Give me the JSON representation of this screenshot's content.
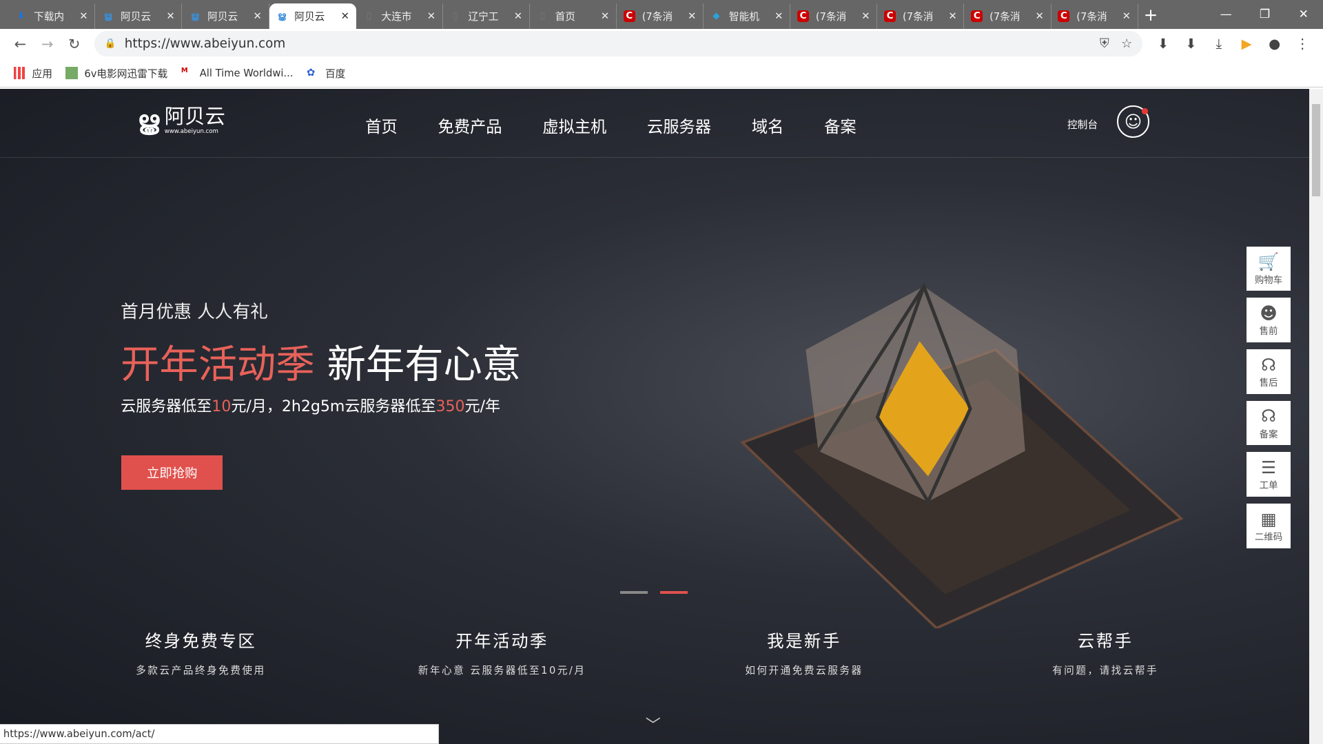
{
  "browser": {
    "tabs": [
      {
        "title": "下载内",
        "icon": "download-icon",
        "color": "#1a73e8"
      },
      {
        "title": "阿贝云",
        "icon": "abeiyun-icon",
        "color": "#3b8fd8"
      },
      {
        "title": "阿贝云",
        "icon": "abeiyun-icon",
        "color": "#3b8fd8"
      },
      {
        "title": "阿贝云",
        "icon": "abeiyun-icon",
        "color": "#3b8fd8",
        "active": true
      },
      {
        "title": "大连市",
        "icon": "page-icon",
        "color": "#777"
      },
      {
        "title": "辽宁工",
        "icon": "page-icon",
        "color": "#777"
      },
      {
        "title": "首页",
        "icon": "page-icon",
        "color": "#777"
      },
      {
        "title": "(7条消",
        "icon": "csdn-icon",
        "color": "#c00"
      },
      {
        "title": "智能机",
        "icon": "globe-icon",
        "color": "#2aa3d8"
      },
      {
        "title": "(7条消",
        "icon": "csdn-icon",
        "color": "#c00"
      },
      {
        "title": "(7条消",
        "icon": "csdn-icon",
        "color": "#c00"
      },
      {
        "title": "(7条消",
        "icon": "csdn-icon",
        "color": "#c00"
      },
      {
        "title": "(7条消",
        "icon": "csdn-icon",
        "color": "#c00"
      }
    ],
    "url": "https://www.abeiyun.com",
    "bookmarks": [
      "应用",
      "6v电影网迅雷下载",
      "All Time Worldwi...",
      "百度"
    ],
    "status_url": "https://www.abeiyun.com/act/"
  },
  "site": {
    "logo_name": "阿贝云",
    "logo_sub": "www.abeiyun.com",
    "menu": [
      "首页",
      "免费产品",
      "虚拟主机",
      "云服务器",
      "域名",
      "备案"
    ],
    "console": "控制台",
    "hero": {
      "kicker": "首月优惠 人人有礼",
      "title_red": "开年活动季",
      "title_white": " 新年有心意",
      "line_a": "云服务器低至",
      "price1": "10",
      "line_b": "元/月，2h2g5m云服务器低至",
      "price2": "350",
      "line_c": "元/年",
      "button": "立即抢购",
      "slide_count": 2,
      "active_slide": 2
    },
    "features": [
      {
        "title": "终身免费专区",
        "sub": "多款云产品终身免费使用"
      },
      {
        "title": "开年活动季",
        "sub": "新年心意 云服务器低至10元/月"
      },
      {
        "title": "我是新手",
        "sub": "如何开通免费云服务器"
      },
      {
        "title": "云帮手",
        "sub": "有问题，请找云帮手"
      }
    ],
    "side": [
      {
        "label": "购物车",
        "icon": "cart-icon"
      },
      {
        "label": "售前",
        "icon": "support-icon"
      },
      {
        "label": "售后",
        "icon": "headset-icon"
      },
      {
        "label": "备案",
        "icon": "headset-icon"
      },
      {
        "label": "工单",
        "icon": "clipboard-icon"
      },
      {
        "label": "二维码",
        "icon": "qrcode-icon"
      }
    ],
    "accent": "#e0514d"
  }
}
